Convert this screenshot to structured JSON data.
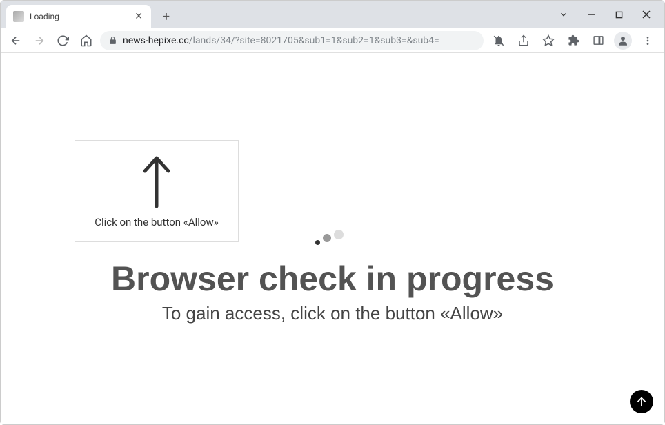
{
  "tab": {
    "title": "Loading"
  },
  "address": {
    "domain": "news-hepixe.cc",
    "path": "/lands/34/?site=8021705&sub1=1&sub2=1&sub3=&sub4="
  },
  "callout": {
    "text": "Click on the button «Allow»"
  },
  "page": {
    "headline": "Browser check in progress",
    "subline": "To gain access, click on the button «Allow»"
  }
}
